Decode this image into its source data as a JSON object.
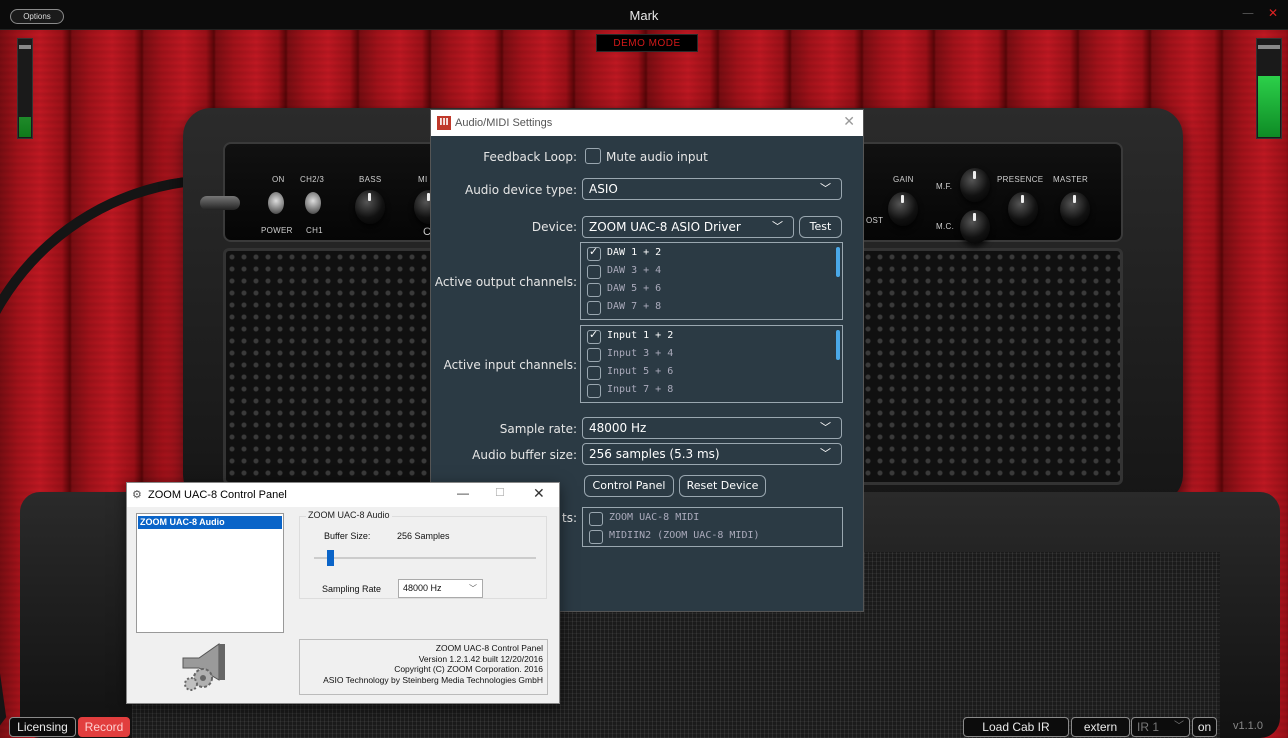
{
  "app": {
    "title": "Mark",
    "options_label": "Options",
    "demo_mode": "DEMO MODE",
    "version": "v1.1.0"
  },
  "meters": {
    "left_level": 0.2,
    "right_level": 0.62
  },
  "amp": {
    "labels": {
      "on": "ON",
      "ch23": "CH2/3",
      "bass": "BASS",
      "mid": "MI",
      "power": "POWER",
      "ch1": "CH1",
      "c": "C",
      "gain": "GAIN",
      "mf": "M.F.",
      "presence": "PRESENCE",
      "master": "MASTER",
      "ost": "OST",
      "mc": "M.C."
    }
  },
  "bottom_bar": {
    "licensing": "Licensing",
    "record": "Record",
    "load_cab_ir": "Load Cab IR",
    "extern": "extern",
    "ir_select": "IR 1",
    "ir_on": "on"
  },
  "midi_dialog": {
    "title": "Audio/MIDI Settings",
    "feedback_loop_label": "Feedback Loop:",
    "mute_audio_input": "Mute audio input",
    "audio_device_type_label": "Audio device type:",
    "audio_device_type_value": "ASIO",
    "device_label": "Device:",
    "device_value": "ZOOM UAC-8 ASIO Driver",
    "test_label": "Test",
    "active_output_label": "Active output channels:",
    "output_channels": [
      {
        "label": "DAW 1 + 2",
        "checked": true
      },
      {
        "label": "DAW 3 + 4",
        "checked": false
      },
      {
        "label": "DAW 5 + 6",
        "checked": false
      },
      {
        "label": "DAW 7 + 8",
        "checked": false
      }
    ],
    "active_input_label": "Active input channels:",
    "input_channels": [
      {
        "label": "Input 1 + 2",
        "checked": true
      },
      {
        "label": "Input 3 + 4",
        "checked": false
      },
      {
        "label": "Input 5 + 6",
        "checked": false
      },
      {
        "label": "Input 7 + 8",
        "checked": false
      }
    ],
    "sample_rate_label": "Sample rate:",
    "sample_rate_value": "48000 Hz",
    "buffer_size_label": "Audio buffer size:",
    "buffer_size_value": "256 samples (5.3 ms)",
    "control_panel_label": "Control Panel",
    "reset_device_label": "Reset Device",
    "midi_inputs_label": "ts:",
    "midi_inputs": [
      {
        "label": "ZOOM UAC-8 MIDI",
        "checked": false
      },
      {
        "label": "MIDIIN2 (ZOOM UAC-8 MIDI)",
        "checked": false
      }
    ]
  },
  "zoom_panel": {
    "title": "ZOOM UAC-8 Control Panel",
    "device_list_item": "ZOOM UAC-8 Audio",
    "group_label": "ZOOM UAC-8 Audio",
    "buffer_size_label": "Buffer Size:",
    "buffer_size_value": "256 Samples",
    "buffer_slider_position": 0.06,
    "sampling_rate_label": "Sampling Rate",
    "sampling_rate_value": "48000 Hz",
    "info_lines": [
      "ZOOM UAC-8 Control Panel",
      "Version 1.2.1.42 built 12/20/2016",
      "Copyright (C) ZOOM Corporation. 2016",
      "ASIO Technology by Steinberg Media Technologies GmbH"
    ]
  }
}
